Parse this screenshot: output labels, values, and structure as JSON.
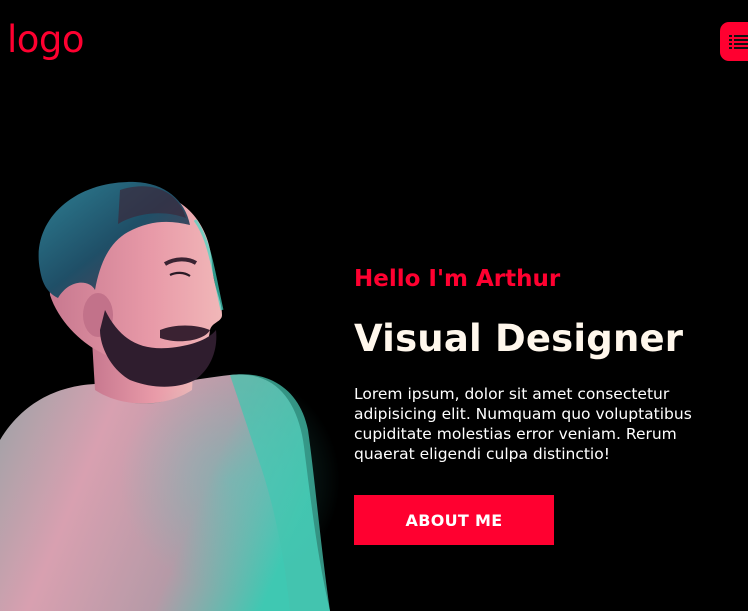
{
  "colors": {
    "background": "#000000",
    "accent": "#FF0030",
    "headline": "#FFF7EC",
    "body_text": "#FFFFFF"
  },
  "header": {
    "logo_text": "logo",
    "menu_icon": "list-icon"
  },
  "hero": {
    "portrait_image": "portrait-photo",
    "greeting": "Hello I'm Arthur",
    "title": "Visual Designer",
    "bio": "Lorem ipsum, dolor sit amet consectetur adipisicing elit. Numquam quo voluptatibus cupiditate molestias error veniam. Rerum quaerat eligendi culpa distinctio!",
    "cta_label": "ABOUT ME"
  }
}
